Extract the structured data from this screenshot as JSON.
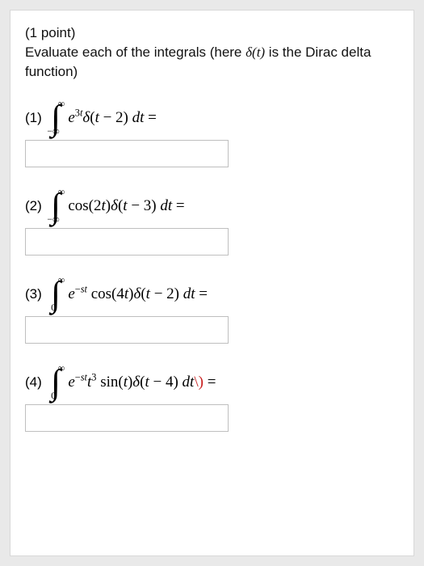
{
  "header": {
    "points": "(1 point)",
    "instruction_a": "Evaluate each of the integrals (here ",
    "instruction_b": " is the Dirac delta function)"
  },
  "delta_sym": "δ(t)",
  "problems": [
    {
      "label": "(1)",
      "lower": "−∞",
      "upper": "∞",
      "integrand_html": "<span class='ital'>e</span><sup>3<span class='ital'>t</span></sup><span class='ital'>δ</span>(<span class='ital'>t</span> − 2)&nbsp;<span class='ital'>dt</span>&nbsp;=",
      "answer": ""
    },
    {
      "label": "(2)",
      "lower": "−∞",
      "upper": "∞",
      "integrand_html": "cos(2<span class='ital'>t</span>)<span class='ital'>δ</span>(<span class='ital'>t</span> − 3)&nbsp;<span class='ital'>dt</span>&nbsp;=",
      "answer": ""
    },
    {
      "label": "(3)",
      "lower": "0",
      "upper": "∞",
      "integrand_html": "<span class='ital'>e</span><sup>−<span class='ital'>st</span></sup>&nbsp;cos(4<span class='ital'>t</span>)<span class='ital'>δ</span>(<span class='ital'>t</span> − 2)&nbsp;<span class='ital'>dt</span>&nbsp;=",
      "answer": ""
    },
    {
      "label": "(4)",
      "lower": "0",
      "upper": "∞",
      "integrand_html": "<span class='ital'>e</span><sup>−<span class='ital'>st</span></sup><span class='ital'>t</span><sup>3</sup>&nbsp;sin(<span class='ital'>t</span>)<span class='ital'>δ</span>(<span class='ital'>t</span> − 4)&nbsp;<span class='ital'>dt</span><span class='red'>\\)</span>&nbsp;=",
      "answer": ""
    }
  ]
}
